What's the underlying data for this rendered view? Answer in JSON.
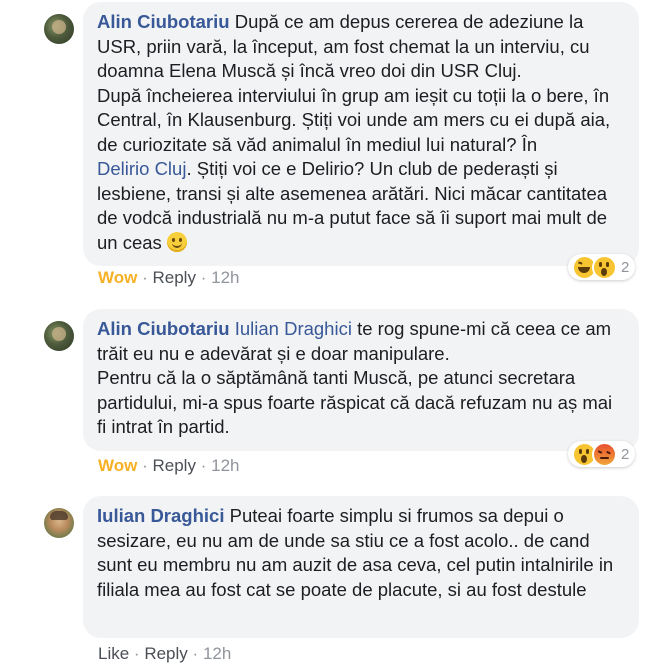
{
  "comments": [
    {
      "author": "Alin Ciubotariu",
      "text_part1": "După ce am depus cererea de adeziune la USR, priin vară, la început, am fost chemat la un interviu, cu doamna Elena Muscă și încă vreo doi din USR Cluj.",
      "text_part2": "După încheierea interviului în grup am ieșit cu toții la o bere, în Central, în Klausenburg. Știți voi unde am mers cu ei după aia, de curiozitate să văd animalul în mediul lui natural? În",
      "link": "Delirio Cluj",
      "text_part3": ". Știți voi ce e Delirio? Un club de pederaști și lesbiene, transi și alte asemenea arătări. Nici măcar cantitatea de vodcă industrială nu m-a putut face să îi suport mai mult de un ceas",
      "emoji": "smile-emoji",
      "action_reaction": "Wow",
      "reply_label": "Reply",
      "time": "12h",
      "reaction_icons": [
        "haha-icon",
        "wow-icon"
      ],
      "reaction_count": "2"
    },
    {
      "author": "Alin Ciubotariu",
      "mention": "Iulian Draghici",
      "text_part1": "te rog spune-mi că ceea ce am trăit eu nu e adevărat și e doar manipulare.",
      "text_part2": "Pentru că la o săptămână tanti Muscă, pe atunci secretara partidului, mi-a spus foarte răspicat că dacă refuzam nu aș mai fi intrat în partid.",
      "action_reaction": "Wow",
      "reply_label": "Reply",
      "time": "12h",
      "reaction_icons": [
        "wow-icon",
        "angry-icon"
      ],
      "reaction_count": "2"
    },
    {
      "author": "Iulian Draghici",
      "text": "Puteai foarte simplu si frumos sa depui o sesizare, eu nu am de unde sa stiu ce a fost acolo.. de cand sunt eu membru nu am auzit de asa ceva, cel putin intalnirile in filiala mea au fost cat se poate de placute, si au fost destule",
      "action_like": "Like",
      "reply_label": "Reply",
      "time": "12h"
    }
  ],
  "separator": "·",
  "colors": {
    "link": "#385898",
    "bubble": "#f2f3f5",
    "wow": "#f7b125",
    "meta": "#90949c"
  }
}
